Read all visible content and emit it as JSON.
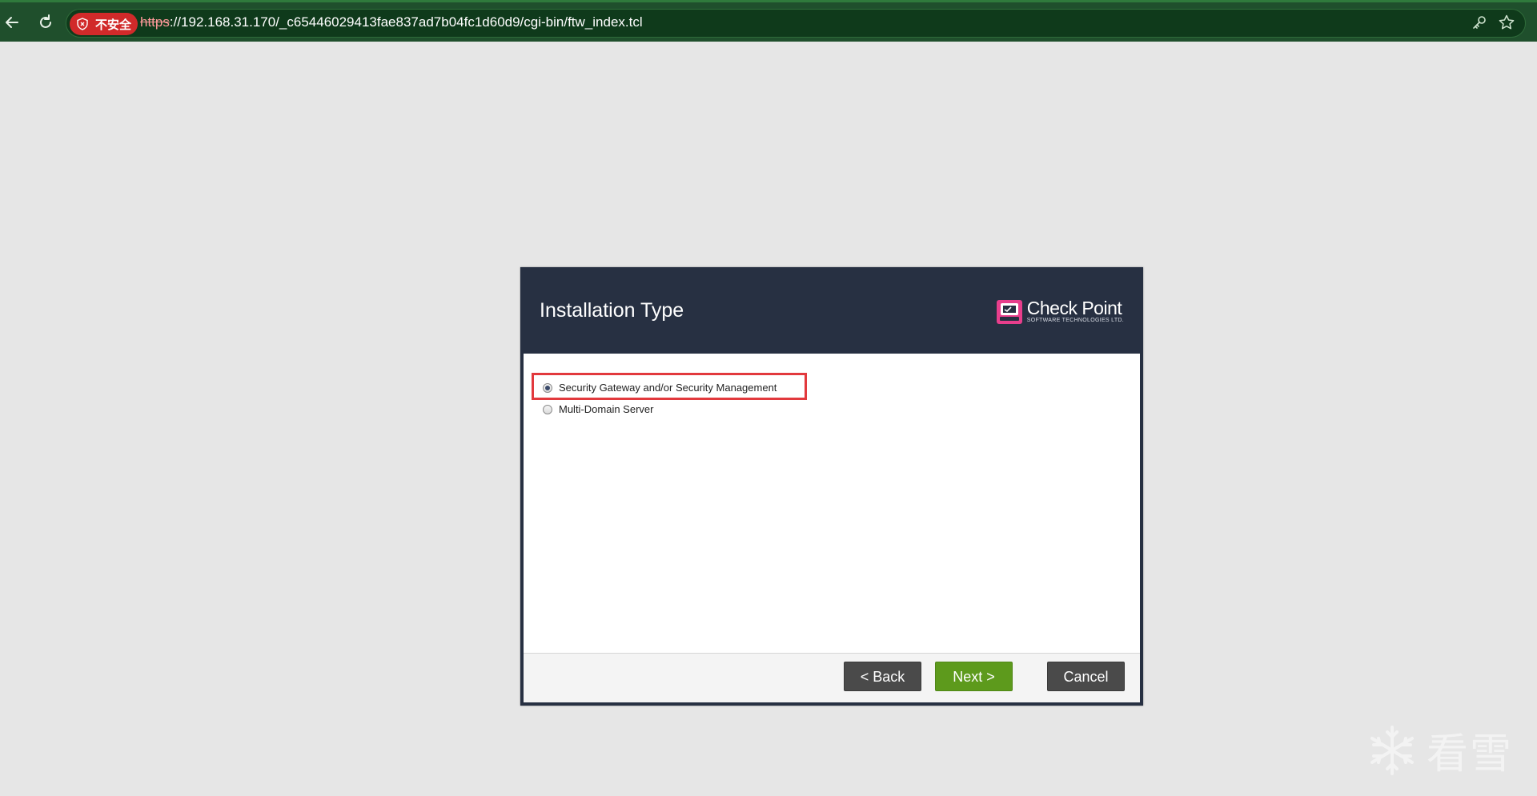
{
  "browser": {
    "security_badge": "不安全",
    "url_scheme": "https",
    "url_rest": "://192.168.31.170/_c65446029413fae837ad7b04fc1d60d9/cgi-bin/ftw_index.tcl",
    "icons": [
      "back-arrow-icon",
      "reload-icon",
      "shield-icon",
      "key-icon",
      "star-icon"
    ]
  },
  "dialog": {
    "title": "Installation Type",
    "logo": {
      "name": "Check Point",
      "subtitle": "SOFTWARE TECHNOLOGIES LTD."
    },
    "options": [
      {
        "label": "Security Gateway and/or Security Management",
        "selected": true
      },
      {
        "label": "Multi-Domain Server",
        "selected": false
      }
    ],
    "buttons": {
      "back": "< Back",
      "next": "Next >",
      "cancel": "Cancel"
    }
  },
  "watermark": {
    "text": "看雪"
  },
  "colors": {
    "browser_bar": "#1f4f2c",
    "dialog_header": "#273042",
    "next_button": "#5d9a1c",
    "dark_button": "#4a4a4a",
    "highlight": "#e2393d",
    "insecure_badge": "#d12a2a"
  }
}
